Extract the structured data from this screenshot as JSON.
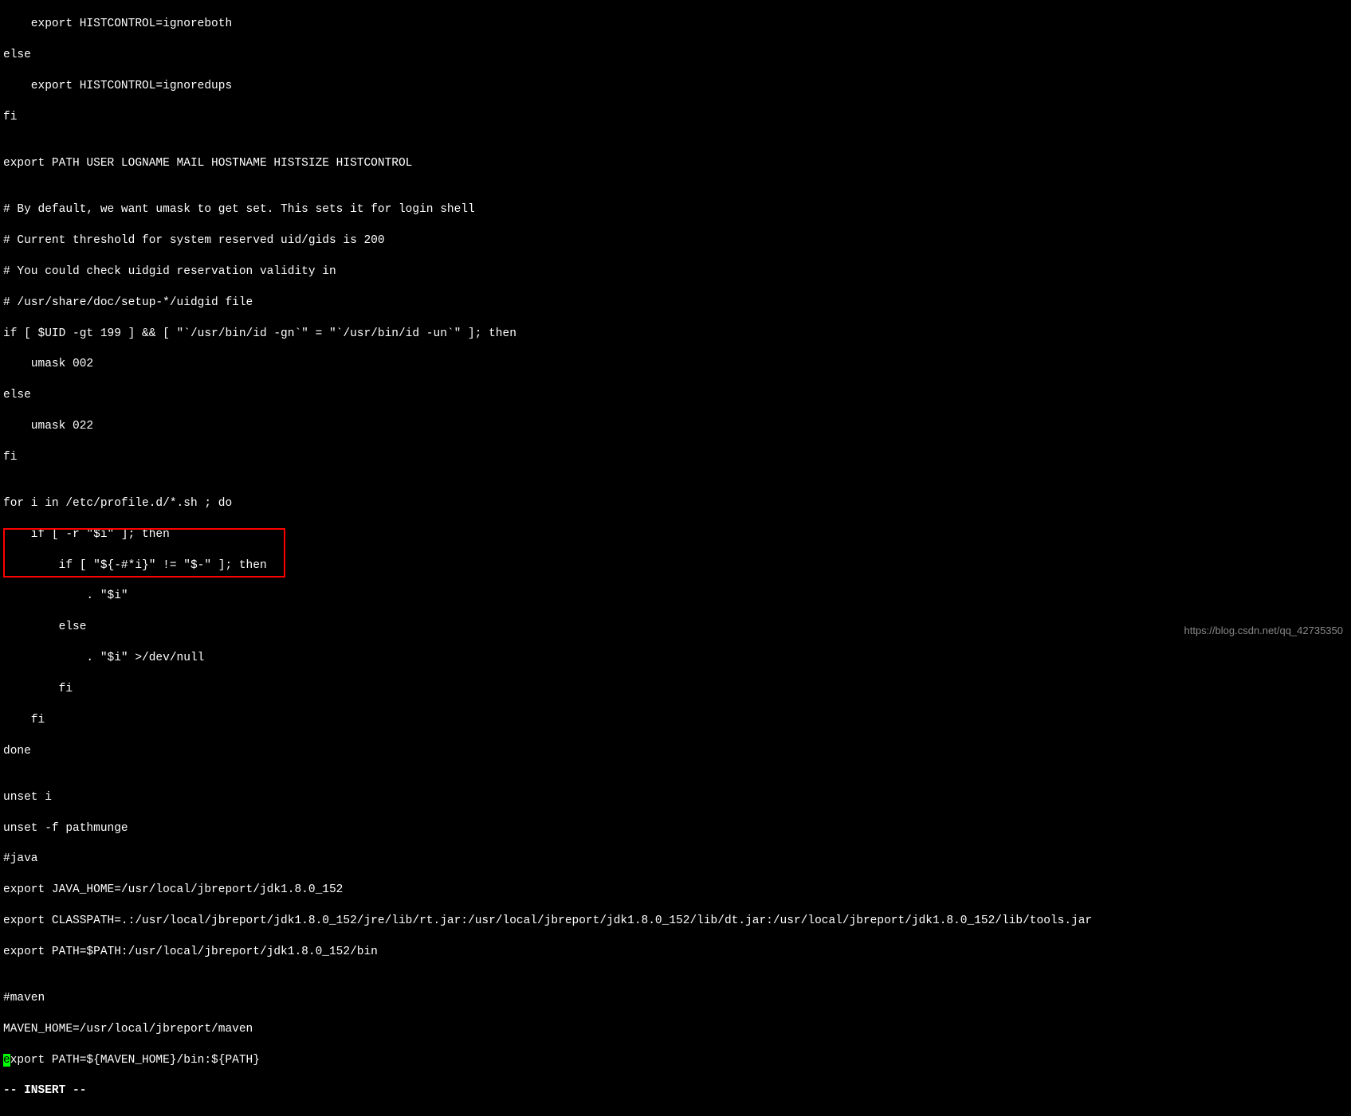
{
  "lines": {
    "l1": "    export HISTCONTROL=ignoreboth",
    "l2": "else",
    "l3": "    export HISTCONTROL=ignoredups",
    "l4": "fi",
    "l5": "",
    "l6": "export PATH USER LOGNAME MAIL HOSTNAME HISTSIZE HISTCONTROL",
    "l7": "",
    "l8": "# By default, we want umask to get set. This sets it for login shell",
    "l9": "# Current threshold for system reserved uid/gids is 200",
    "l10": "# You could check uidgid reservation validity in",
    "l11": "# /usr/share/doc/setup-*/uidgid file",
    "l12": "if [ $UID -gt 199 ] && [ \"`/usr/bin/id -gn`\" = \"`/usr/bin/id -un`\" ]; then",
    "l13": "    umask 002",
    "l14": "else",
    "l15": "    umask 022",
    "l16": "fi",
    "l17": "",
    "l18": "for i in /etc/profile.d/*.sh ; do",
    "l19": "    if [ -r \"$i\" ]; then",
    "l20": "        if [ \"${-#*i}\" != \"$-\" ]; then",
    "l21": "            . \"$i\"",
    "l22": "        else",
    "l23": "            . \"$i\" >/dev/null",
    "l24": "        fi",
    "l25": "    fi",
    "l26": "done",
    "l27": "",
    "l28": "unset i",
    "l29": "unset -f pathmunge",
    "l30": "#java",
    "l31": "export JAVA_HOME=/usr/local/jbreport/jdk1.8.0_152",
    "l32": "export CLASSPATH=.:/usr/local/jbreport/jdk1.8.0_152/jre/lib/rt.jar:/usr/local/jbreport/jdk1.8.0_152/lib/dt.jar:/usr/local/jbreport/jdk1.8.0_152/lib/tools.jar",
    "l33": "export PATH=$PATH:/usr/local/jbreport/jdk1.8.0_152/bin",
    "l34": "",
    "l35": "#maven",
    "l36": "MAVEN_HOME=/usr/local/jbreport/maven",
    "l37_cursor": "e",
    "l37_rest": "xport PATH=${MAVEN_HOME}/bin:${PATH}",
    "l38": "-- INSERT --"
  },
  "watermark": "https://blog.csdn.net/qq_42735350"
}
